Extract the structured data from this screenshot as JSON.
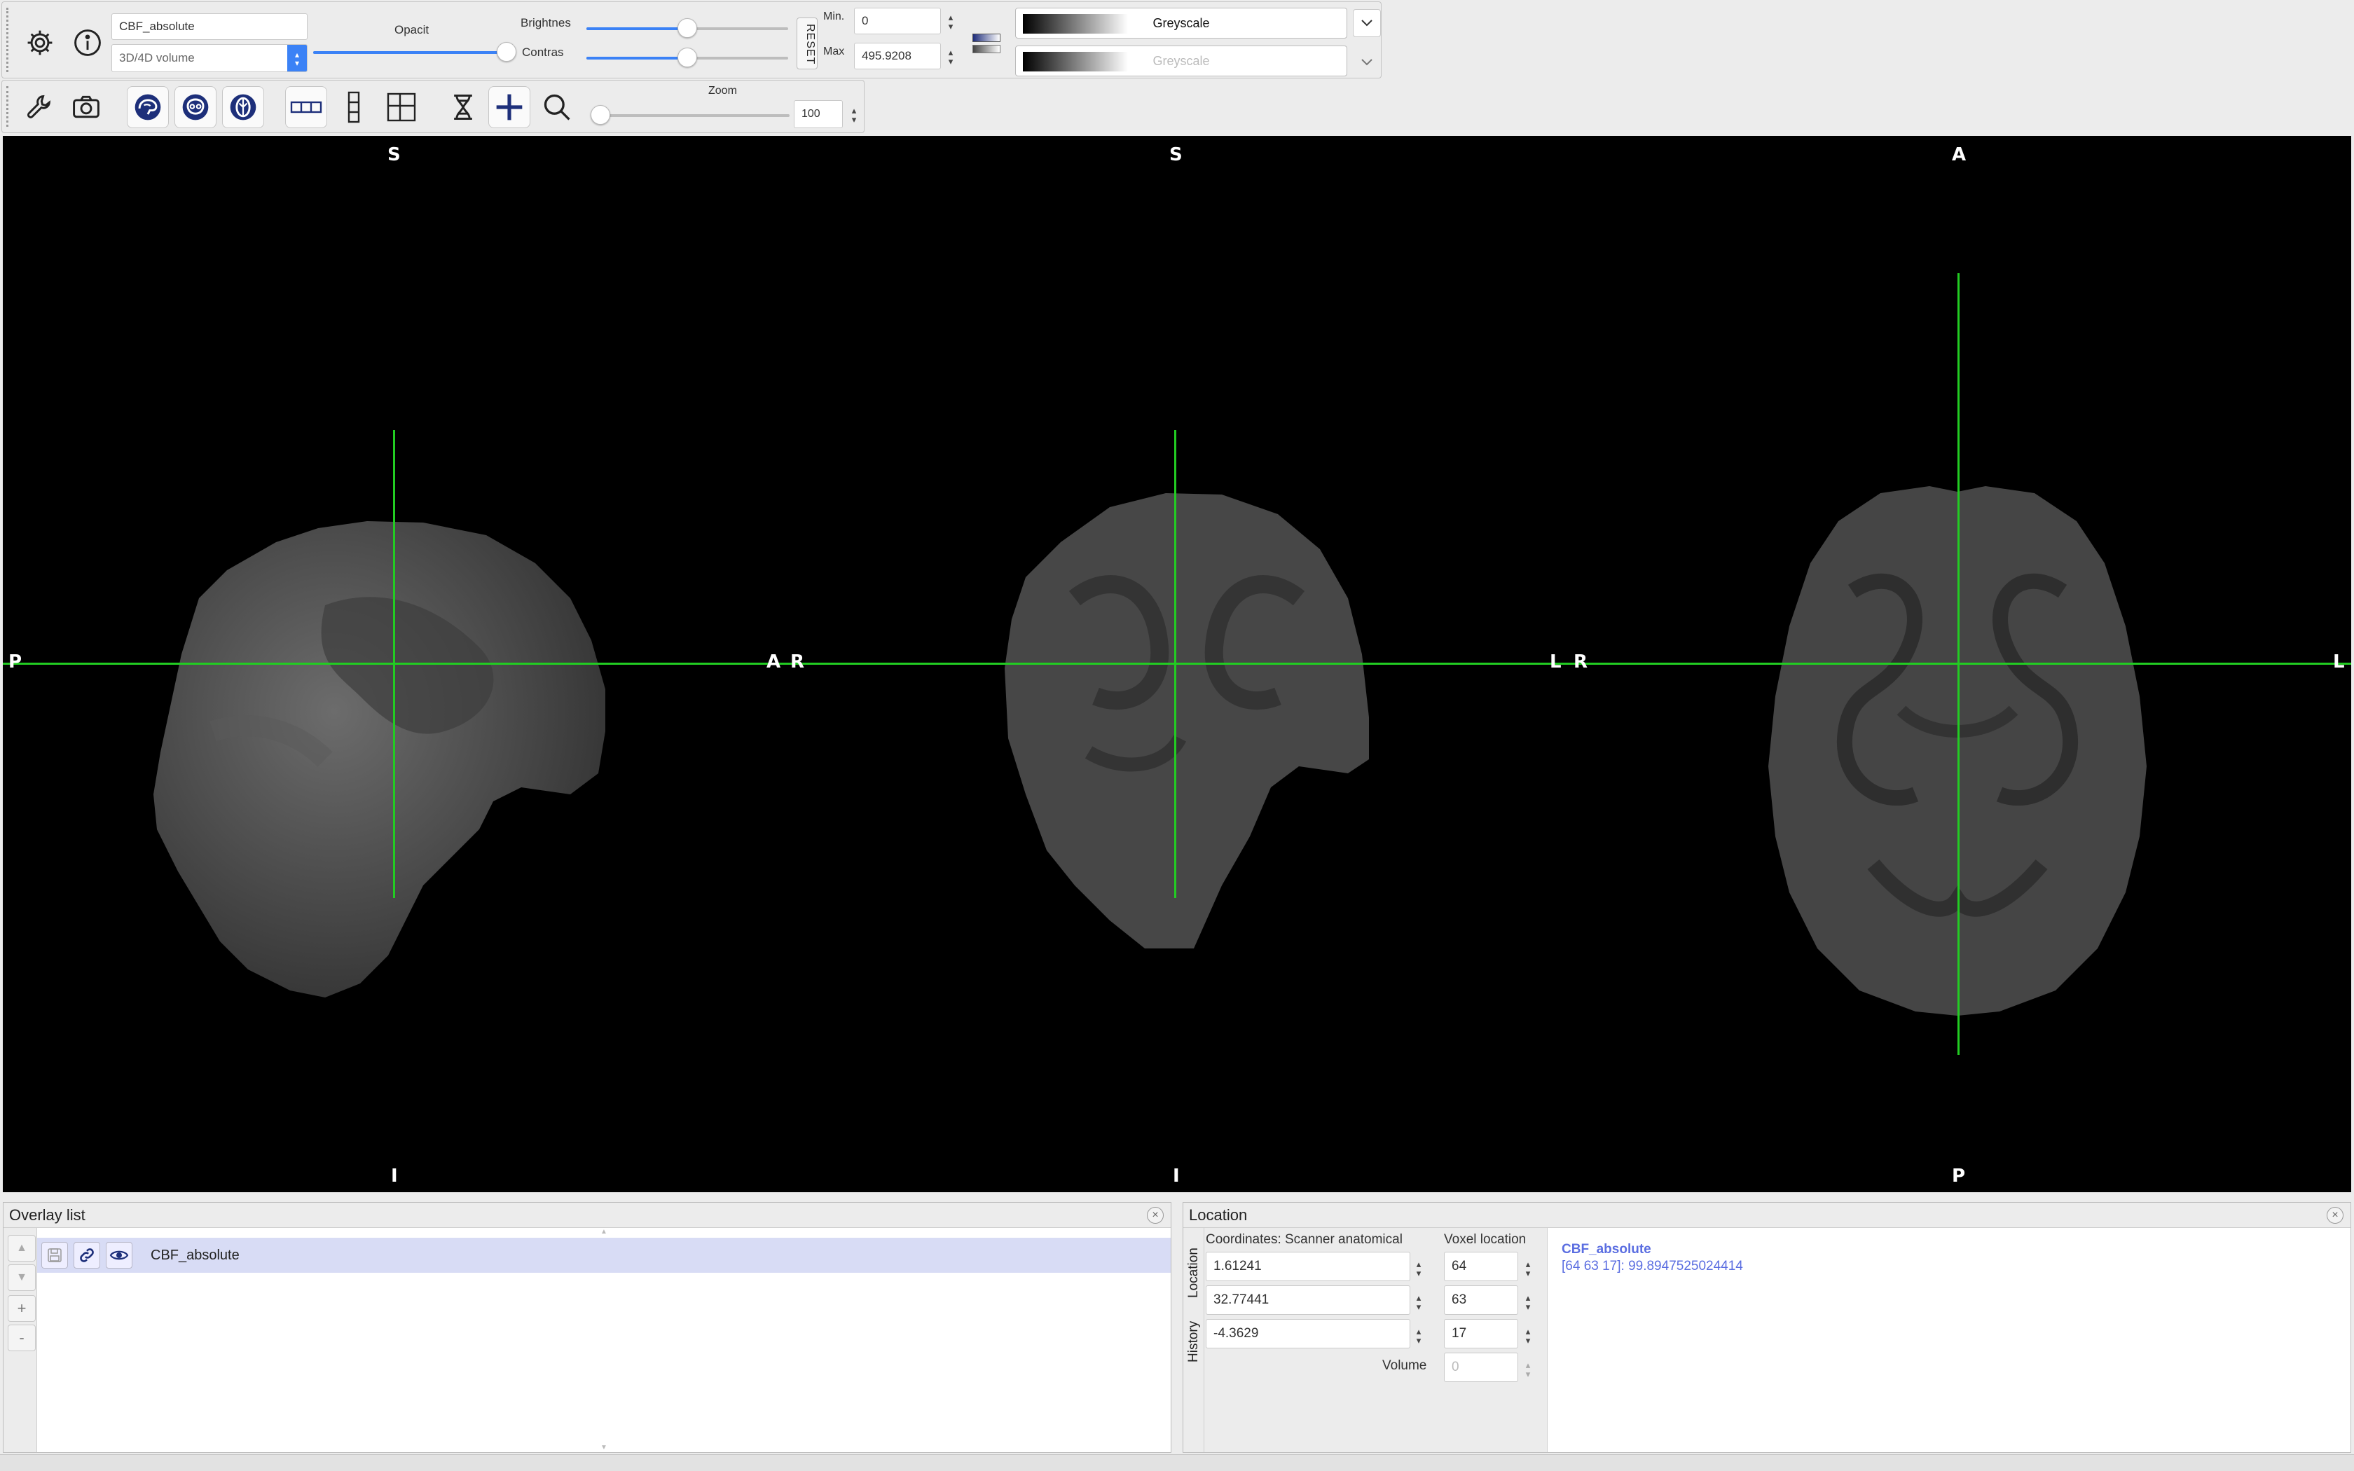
{
  "toolbar_top": {
    "overlay_name": "CBF_absolute",
    "volume_type": "3D/4D volume",
    "opacity_label": "Opacit",
    "brightness_label": "Brightnes",
    "contrast_label": "Contras",
    "reset_label": "RESET",
    "min_label": "Min.",
    "max_label": "Max",
    "min_value": "0",
    "max_value": "495.9208",
    "colormap_primary": "Greyscale",
    "colormap_secondary": "Greyscale",
    "opacity": 1.0,
    "brightness": 0.5,
    "contrast": 0.5
  },
  "toolbar_view": {
    "zoom_label": "Zoom",
    "zoom_value": "100",
    "zoom": 0.0
  },
  "viewer": {
    "sagittal": {
      "top": "S",
      "bottom": "I",
      "left": "P",
      "right": "A"
    },
    "coronal": {
      "top": "S",
      "bottom": "I",
      "left": "R",
      "right": "L"
    },
    "axial": {
      "top": "A",
      "bottom": "P",
      "left": "R",
      "right": "L"
    },
    "crosshair_color": "#22cc22"
  },
  "overlay_panel": {
    "title": "Overlay list",
    "items": [
      {
        "name": "CBF_absolute"
      }
    ],
    "buttons": {
      "up": "▲",
      "down": "▼",
      "add": "+",
      "remove": "-"
    }
  },
  "location_panel": {
    "title": "Location",
    "tab_location": "Location",
    "tab_history": "History",
    "coord_label": "Coordinates: Scanner anatomical",
    "voxel_label": "Voxel location",
    "coords": [
      "1.61241",
      "32.77441",
      "-4.3629"
    ],
    "voxels": [
      "64",
      "63",
      "17"
    ],
    "volume_label": "Volume",
    "volume_value": "0",
    "info_name": "CBF_absolute",
    "info_value": "[64 63 17]: 99.8947525024414",
    "info_color": "#5b6ee1"
  }
}
